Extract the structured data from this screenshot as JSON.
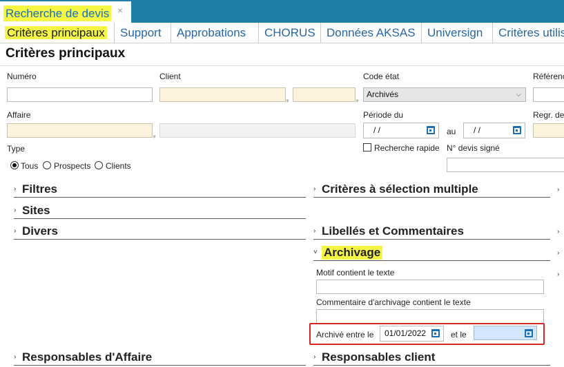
{
  "window": {
    "title": "Recherche de devis",
    "close_glyph": "×"
  },
  "tabs": [
    {
      "label": "Critères principaux"
    },
    {
      "label": "Support"
    },
    {
      "label": "Approbations"
    },
    {
      "label": "CHORUS"
    },
    {
      "label": "Données AKSAS"
    },
    {
      "label": "Universign"
    },
    {
      "label": "Critères utilis"
    }
  ],
  "page_title": "Critères principaux",
  "fields": {
    "numero": {
      "label": "Numéro",
      "value": ""
    },
    "client": {
      "label": "Client",
      "value": ""
    },
    "code_etat": {
      "label": "Code état",
      "value": "Archivés"
    },
    "reference": {
      "label": "Référenc"
    },
    "affaire": {
      "label": "Affaire",
      "value": ""
    },
    "periode": {
      "label": "Période du",
      "from": " /  /",
      "au_label": "au",
      "to": " /  /"
    },
    "regr": {
      "label": "Regr. de"
    },
    "type": {
      "label": "Type",
      "options": [
        "Tous",
        "Prospects",
        "Clients"
      ],
      "selected": "Tous"
    },
    "recherche_rapide": {
      "label": "Recherche rapide"
    },
    "devis_signe": {
      "label": "N° devis signé",
      "value": ""
    }
  },
  "sections": {
    "filtres": "Filtres",
    "sites": "Sites",
    "divers": "Divers",
    "criteres_multiples": "Critères à sélection multiple",
    "libelles": "Libellés et Commentaires",
    "archivage": "Archivage",
    "responsables_affaire": "Responsables d'Affaire",
    "responsables_client": "Responsables client"
  },
  "archivage": {
    "motif_label": "Motif contient le texte",
    "commentaire_label": "Commentaire d'archivage contient le texte",
    "entre_label": "Archivé entre le",
    "date_from": "01/01/2022",
    "et_le_label": "et le",
    "date_to": ""
  },
  "colors": {
    "titlebar": "#1e7fa8",
    "highlight": "#f6f645",
    "tab_text": "#2767a4",
    "red_box": "#d42525"
  }
}
